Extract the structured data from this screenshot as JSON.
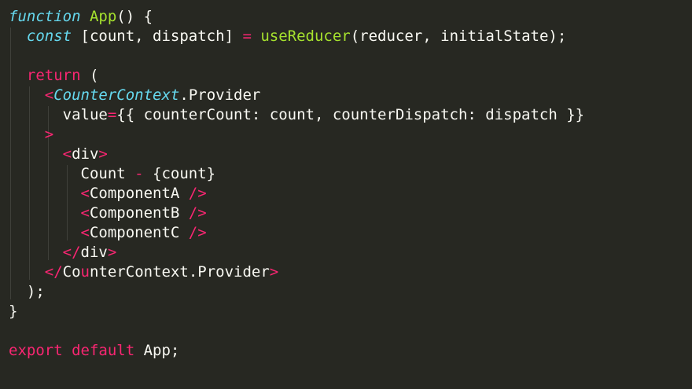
{
  "code": {
    "l1": {
      "kw": "function",
      "name": "App",
      "rest": "() {"
    },
    "l2": {
      "kw": "const",
      "pre": " [count, dispatch] ",
      "eq": "=",
      "sp": " ",
      "fn": "useReducer",
      "args": "(reducer, initialState);"
    },
    "l4": {
      "kw": "return",
      "rest": " ("
    },
    "l5": {
      "lt": "<",
      "comp": "CounterContext",
      "rest": ".Provider"
    },
    "l6": {
      "attr": "value",
      "eq": "=",
      "rest": "{{ counterCount: count, counterDispatch: dispatch }}"
    },
    "l7": {
      "gt": ">"
    },
    "l8": {
      "lt": "<",
      "tag": "div",
      "gt": ">"
    },
    "l9": {
      "text": "Count ",
      "op": "-",
      "expr": " {count}"
    },
    "l10": {
      "lt": "<",
      "name": "ComponentA",
      "close": " />"
    },
    "l11": {
      "lt": "<",
      "name": "ComponentB",
      "close": " />"
    },
    "l12": {
      "lt": "<",
      "name": "ComponentC",
      "close": " />"
    },
    "l13": {
      "lt": "</",
      "tag": "div",
      "gt": ">"
    },
    "l14": {
      "lt": "</",
      "compA": "Co",
      "compB": "u",
      "compC": "nterContext",
      "rest": ".Provider",
      "gt": ">"
    },
    "l15": {
      "text": ");"
    },
    "l16": {
      "text": "}"
    },
    "l18": {
      "kw1": "export",
      "kw2": "default",
      "rest": " App;"
    }
  },
  "colors": {
    "background": "#272822",
    "keyword": "#f92672",
    "function": "#a6e22e",
    "component": "#66d9ef",
    "text": "#f8f8f2"
  }
}
